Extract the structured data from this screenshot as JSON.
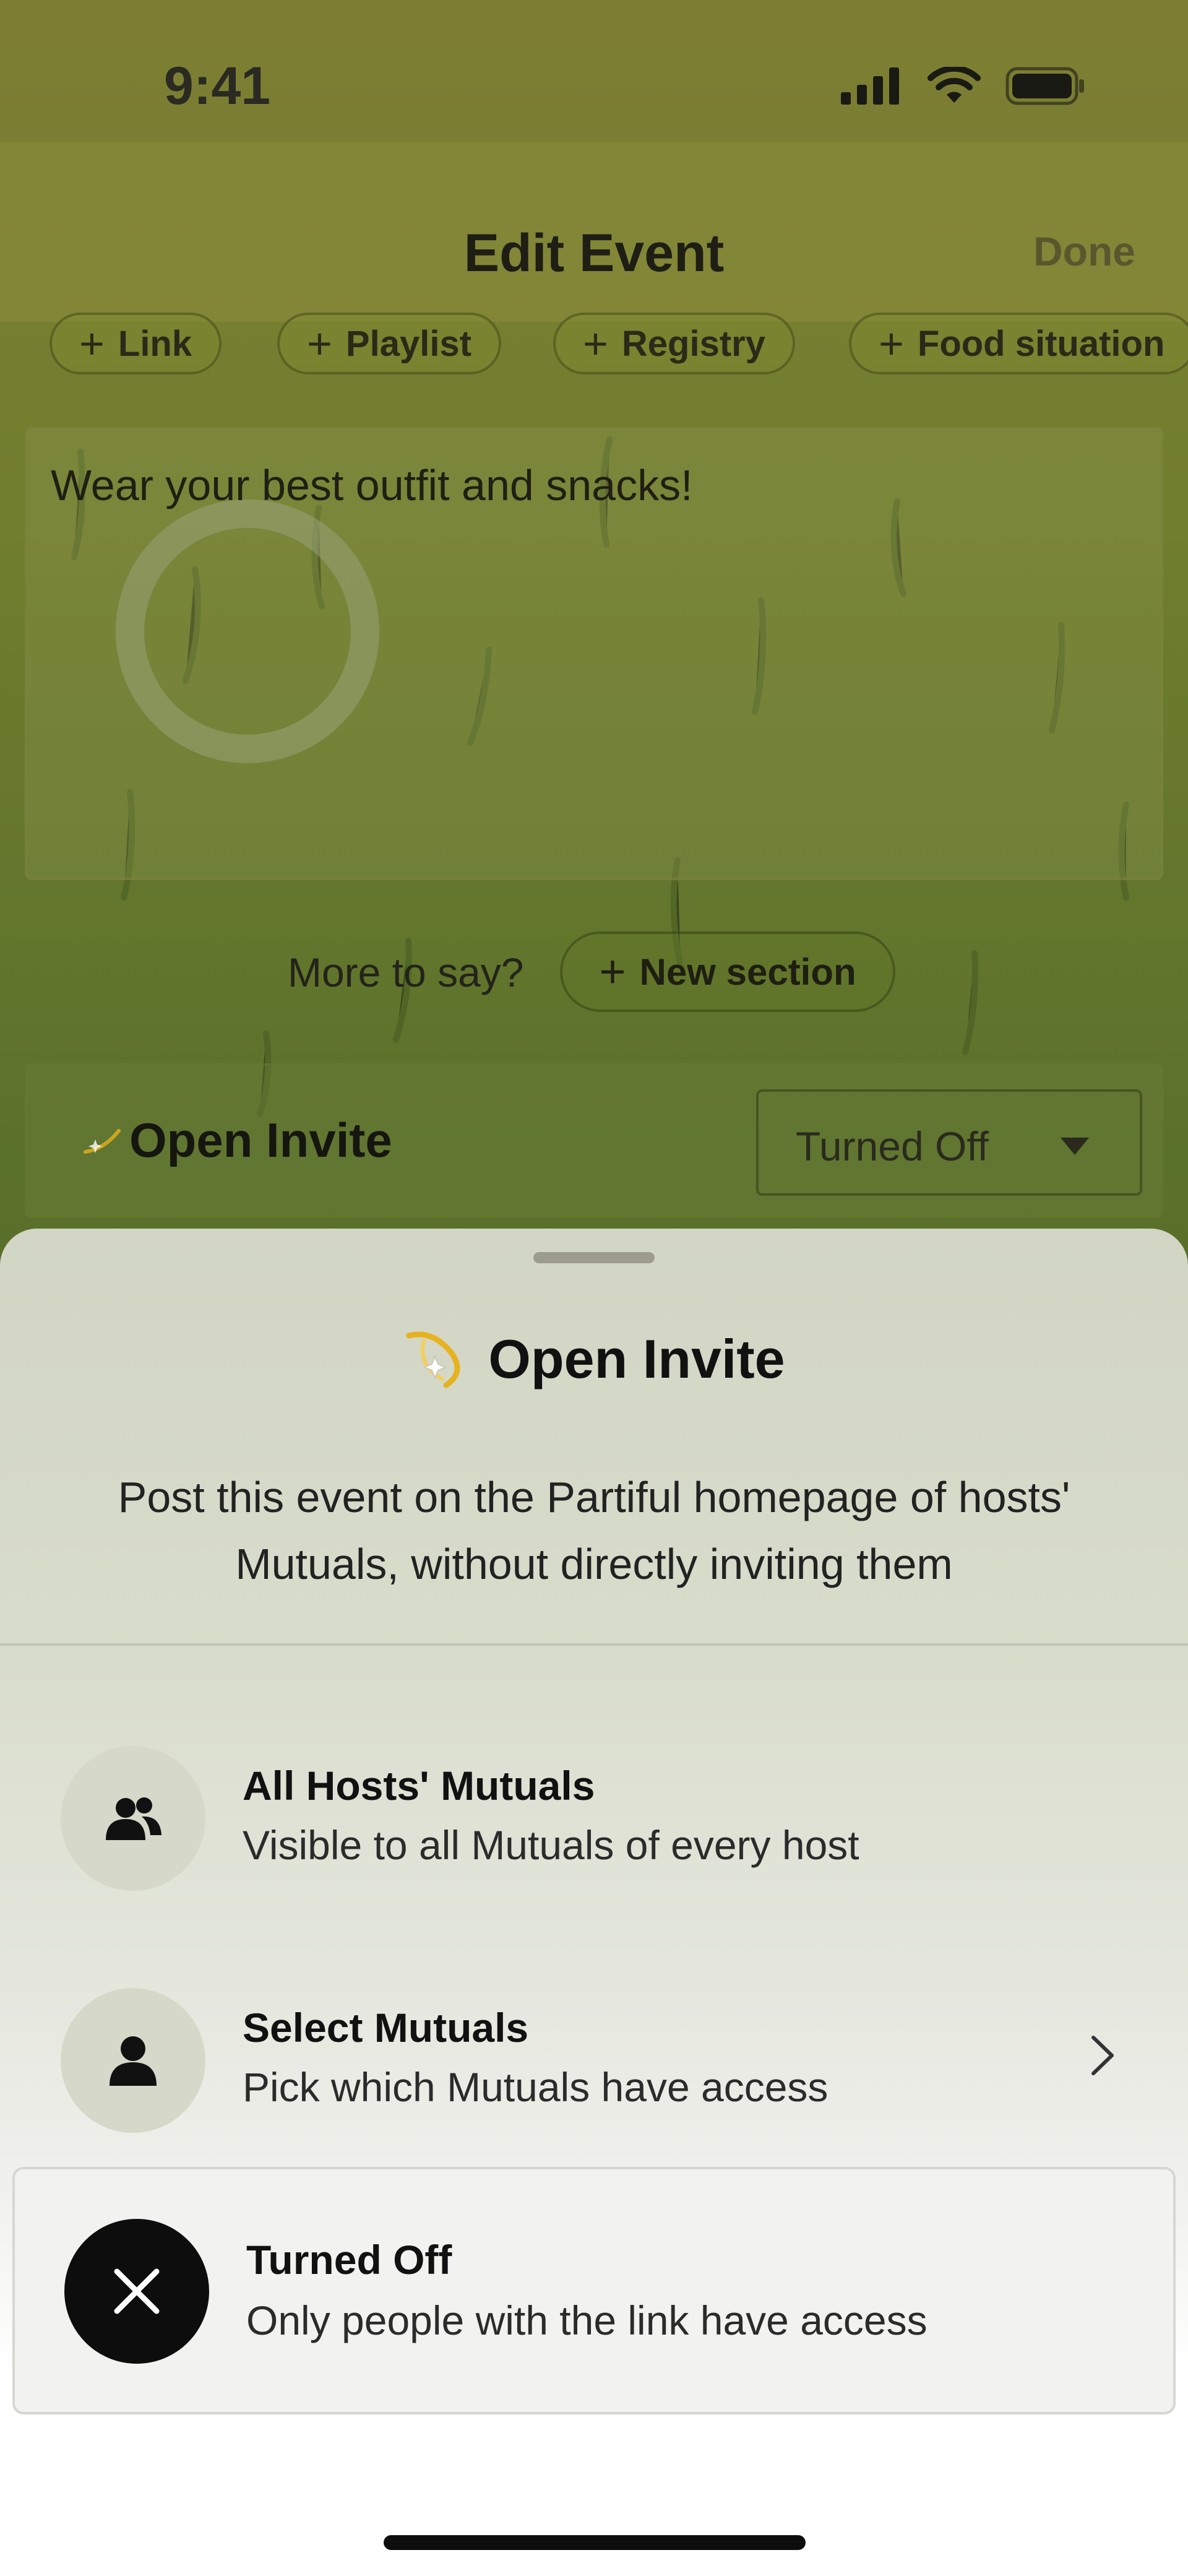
{
  "status_bar": {
    "time": "9:41"
  },
  "nav": {
    "title": "Edit Event",
    "done_label": "Done"
  },
  "chips": [
    {
      "label": "Link"
    },
    {
      "label": "Playlist"
    },
    {
      "label": "Registry"
    },
    {
      "label": "Food situation"
    }
  ],
  "description": {
    "text": "Wear your best outfit and snacks!"
  },
  "more_section": {
    "prompt": "More to say?",
    "button_label": "New section"
  },
  "open_invite_row": {
    "label": "Open Invite",
    "selected_value": "Turned Off"
  },
  "sheet": {
    "title": "Open Invite",
    "description": "Post this event on the Partiful homepage of hosts' Mutuals, without directly inviting them",
    "options": [
      {
        "title": "All Hosts' Mutuals",
        "subtitle": "Visible to all Mutuals of every host",
        "icon": "group-icon"
      },
      {
        "title": "Select Mutuals",
        "subtitle": "Pick which Mutuals have access",
        "icon": "person-icon"
      },
      {
        "title": "Turned Off",
        "subtitle": "Only people with the link have access",
        "icon": "close-icon",
        "selected": true
      }
    ]
  },
  "colors": {
    "selected_icon_bg": "#0d0d0d",
    "icon_circle_bg": "#d6d8c9",
    "accent_gold": "#e6b21f"
  }
}
